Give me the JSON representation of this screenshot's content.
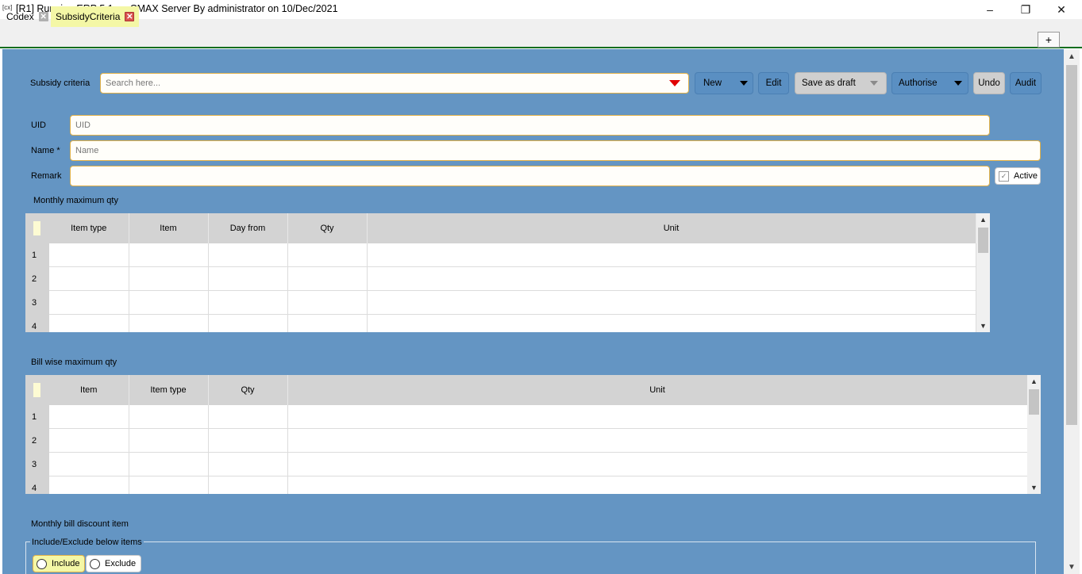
{
  "window": {
    "icon_text": "[cx]",
    "title": "[R1] Running ERP 5.1 on CMAX Server By administrator on 10/Dec/2021",
    "minimize": "–",
    "restore": "❐",
    "close": "✕"
  },
  "tabs": [
    {
      "label": "Codex",
      "close": "✕"
    },
    {
      "label": "SubsidyCriteria",
      "close": "✕"
    }
  ],
  "add_tab": "+",
  "toolbar": {
    "criteria_label": "Subsidy criteria",
    "search_placeholder": "Search here...",
    "new": "New",
    "edit": "Edit",
    "save_draft": "Save as draft",
    "authorise": "Authorise",
    "undo": "Undo",
    "audit": "Audit"
  },
  "form": {
    "uid_label": "UID",
    "uid_placeholder": "UID",
    "name_label": "Name *",
    "name_placeholder": "Name",
    "remark_label": "Remark",
    "active_label": "Active",
    "active_checked": true
  },
  "monthly_grid": {
    "title": "Monthly maximum qty",
    "columns": [
      "Item type",
      "Item",
      "Day from",
      "Qty",
      "Unit"
    ],
    "rows": [
      "1",
      "2",
      "3",
      "4"
    ]
  },
  "bill_grid": {
    "title": "Bill wise maximum qty",
    "columns": [
      "Item",
      "Item type",
      "Qty",
      "Unit"
    ],
    "rows": [
      "1",
      "2",
      "3",
      "4"
    ]
  },
  "discount": {
    "title": "Monthly bill discount item",
    "group_label": "Include/Exclude below items",
    "include": "Include",
    "exclude": "Exclude"
  },
  "colors": {
    "main_bg": "#6495c3",
    "accent_border": "#e0b048",
    "tab_active": "#f4f7a6",
    "tab_underline": "#0f6e1f"
  }
}
